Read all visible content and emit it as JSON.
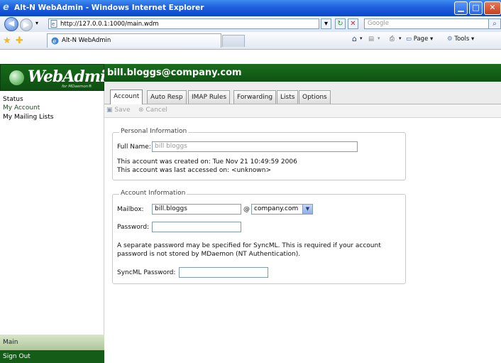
{
  "browser": {
    "title": "Alt-N WebAdmin - Windows Internet Explorer",
    "url": "http://127.0.0.1:1000/main.wdm",
    "search_placeholder": "Google",
    "tab_title": "Alt-N WebAdmin",
    "tools": {
      "page": "Page ▾",
      "tools": "Tools ▾"
    }
  },
  "logo": {
    "word": "WebAdmin",
    "sub": "for MDaemon®"
  },
  "sidebar": {
    "items": [
      {
        "label": "Status"
      },
      {
        "label": "My Account"
      },
      {
        "label": "My Mailing Lists"
      }
    ],
    "main": "Main",
    "sign_out": "Sign Out"
  },
  "header": {
    "account": "bill.bloggs@company.com"
  },
  "tabs": [
    {
      "label": "Account"
    },
    {
      "label": "Auto Resp"
    },
    {
      "label": "IMAP Rules"
    },
    {
      "label": "Forwarding"
    },
    {
      "label": "Lists"
    },
    {
      "label": "Options"
    }
  ],
  "toolbar": {
    "save": "Save",
    "cancel": "Cancel"
  },
  "personal": {
    "legend": "Personal Information",
    "full_name_label": "Full Name:",
    "full_name_value": "bill bloggs",
    "created": "This account was created on: Tue Nov 21 10:49:59 2006",
    "accessed": "This account was last accessed on: <unknown>"
  },
  "account": {
    "legend": "Account Information",
    "mailbox_label": "Mailbox:",
    "mailbox_value": "bill.bloggs",
    "at": "@",
    "domain": "company.com",
    "password_label": "Password:",
    "note_line1": "A separate password may be specified for SyncML. This is required if your account",
    "note_line2": "password is not stored by MDaemon (NT Authentication).",
    "syncml_label": "SyncML Password:"
  }
}
